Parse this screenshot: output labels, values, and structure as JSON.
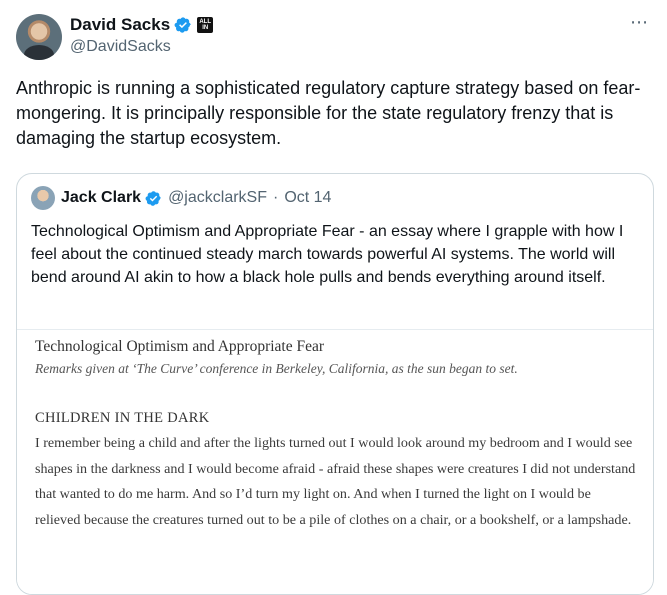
{
  "tweet": {
    "author_name": "David Sacks",
    "author_handle": "@DavidSacks",
    "affiliation_badge": "ALL IN",
    "text": "Anthropic is running a sophisticated regulatory capture strategy based on fear-mongering. It is principally responsible for the state regulatory frenzy that is damaging the startup ecosystem.",
    "more_icon": "more-icon",
    "verified_icon": "verified-badge-icon"
  },
  "quoted_tweet": {
    "author_name": "Jack Clark",
    "author_handle": "@jackclarkSF",
    "separator": "·",
    "date": "Oct 14",
    "text": "Technological Optimism and Appropriate Fear - an essay where I grapple with how I feel about the continued steady march towards powerful AI systems. The world will bend around AI akin to how a black hole pulls and bends everything around itself.",
    "image": {
      "title": "Technological Optimism and Appropriate Fear",
      "subtitle": "Remarks given at ‘The Curve’ conference in Berkeley, California, as the sun began to set.",
      "heading": "CHILDREN IN THE DARK",
      "paragraph": "I remember being a child and after the lights turned out I would look around my bedroom and I would see shapes in the darkness and I would become afraid - afraid these shapes were creatures I did not understand that wanted to do me harm. And so I’d turn my light on. And when I turned the light on I would be relieved because the creatures turned out to be a pile of clothes on a chair, or a bookshelf, or a lampshade."
    }
  },
  "colors": {
    "accent": "#1d9bf0",
    "text": "#0f1419",
    "muted": "#536471",
    "border": "#cfd9de"
  }
}
